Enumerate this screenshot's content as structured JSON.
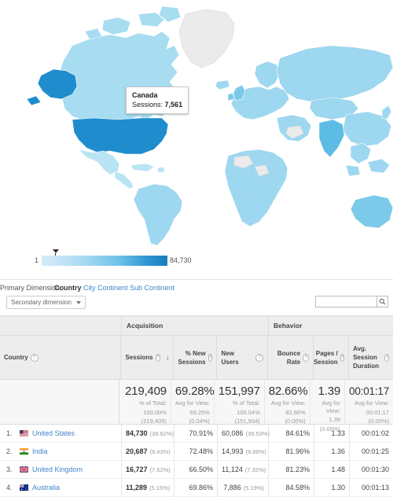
{
  "map": {
    "tooltip": {
      "country": "Canada",
      "metric_label": "Sessions:",
      "metric_value": "7,561"
    },
    "legend": {
      "min": "1",
      "max": "84,730"
    }
  },
  "primary_dimension": {
    "label": "Primary Dimension:",
    "current": "Country",
    "links": [
      "City",
      "Continent",
      "Sub Continent"
    ]
  },
  "controls": {
    "secondary_dimension": "Secondary dimension",
    "search_value": "",
    "search_placeholder": ""
  },
  "table": {
    "groups": {
      "blank": "",
      "acquisition": "Acquisition",
      "behavior": "Behavior"
    },
    "headers": {
      "country": "Country",
      "sessions": "Sessions",
      "new_sessions": "% New Sessions",
      "new_users": "New Users",
      "bounce_rate": "Bounce Rate",
      "pages_session": "Pages / Session",
      "avg_duration": "Avg. Session Duration"
    },
    "sort_indicator": "↓",
    "totals": {
      "sessions": {
        "value": "219,409",
        "l1": "% of Total:",
        "l2": "100.00%",
        "l3": "(219,409)"
      },
      "new_sessions": {
        "value": "69.28%",
        "l1": "Avg for View:",
        "l2": "69.25%",
        "l3": "(0.04%)"
      },
      "new_users": {
        "value": "151,997",
        "l1": "% of Total:",
        "l2": "100.04%",
        "l3": "(151,934)"
      },
      "bounce_rate": {
        "value": "82.66%",
        "l1": "Avg for View:",
        "l2": "82.66%",
        "l3": "(0.00%)"
      },
      "pages_session": {
        "value": "1.39",
        "l1": "Avg for View:",
        "l2": "1.39",
        "l3": "(0.00%)"
      },
      "avg_duration": {
        "value": "00:01:17",
        "l1": "Avg for View:",
        "l2": "00:01:17",
        "l3": "(0.00%)"
      }
    },
    "rows": [
      {
        "rank": "1.",
        "country": "United States",
        "flag": "flag-us",
        "sessions": "84,730",
        "sessions_pct": "(38.62%)",
        "new_sessions": "70.91%",
        "new_users": "60,086",
        "new_users_pct": "(39.53%)",
        "bounce_rate": "84.61%",
        "pages_session": "1.33",
        "avg_duration": "00:01:02"
      },
      {
        "rank": "2.",
        "country": "India",
        "flag": "flag-in",
        "sessions": "20,687",
        "sessions_pct": "(9.43%)",
        "new_sessions": "72.48%",
        "new_users": "14,993",
        "new_users_pct": "(9.86%)",
        "bounce_rate": "81.96%",
        "pages_session": "1.36",
        "avg_duration": "00:01:25"
      },
      {
        "rank": "3.",
        "country": "United Kingdom",
        "flag": "flag-gb",
        "sessions": "16,727",
        "sessions_pct": "(7.62%)",
        "new_sessions": "66.50%",
        "new_users": "11,124",
        "new_users_pct": "(7.32%)",
        "bounce_rate": "81.23%",
        "pages_session": "1.48",
        "avg_duration": "00:01:30"
      },
      {
        "rank": "4.",
        "country": "Australia",
        "flag": "flag-au",
        "sessions": "11,289",
        "sessions_pct": "(5.15%)",
        "new_sessions": "69.86%",
        "new_users": "7,886",
        "new_users_pct": "(5.19%)",
        "bounce_rate": "84.58%",
        "pages_session": "1.30",
        "avg_duration": "00:01:13"
      }
    ]
  },
  "colors": {
    "link": "#4285c8",
    "map_low": "#d5ecf8",
    "map_mid": "#8dd0ec",
    "map_high": "#1a7dbd",
    "map_nodata": "#ebebeb"
  }
}
